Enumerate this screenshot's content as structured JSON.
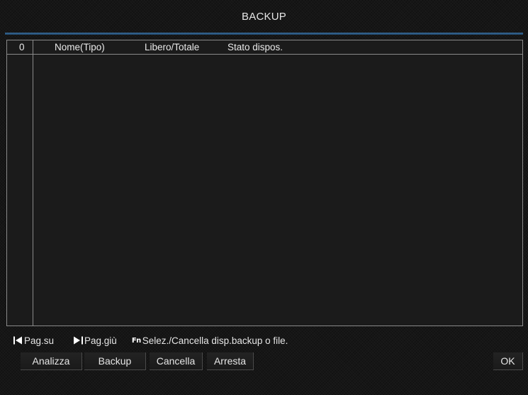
{
  "window": {
    "title": "BACKUP"
  },
  "table": {
    "columns": {
      "index": "0",
      "name": "Nome(Tipo)",
      "free_total": "Libero/Totale",
      "state": "Stato dispos."
    },
    "rows": []
  },
  "hints": {
    "page_up": "Pag.su",
    "page_down": "Pag.giù",
    "fn_label": "Fn",
    "fn_action": "Selez./Cancella disp.backup o file."
  },
  "buttons": {
    "analyze": "Analizza",
    "backup": "Backup",
    "delete": "Cancella",
    "stop": "Arresta",
    "ok": "OK"
  },
  "colors": {
    "background": "#161616",
    "accent_line": "#3a6d9c",
    "text": "#e6e6e6",
    "border": "#8a8a8a"
  },
  "icons": {
    "page_up": "skip-back-icon",
    "page_down": "skip-forward-icon",
    "fn": "fn-key-icon"
  }
}
